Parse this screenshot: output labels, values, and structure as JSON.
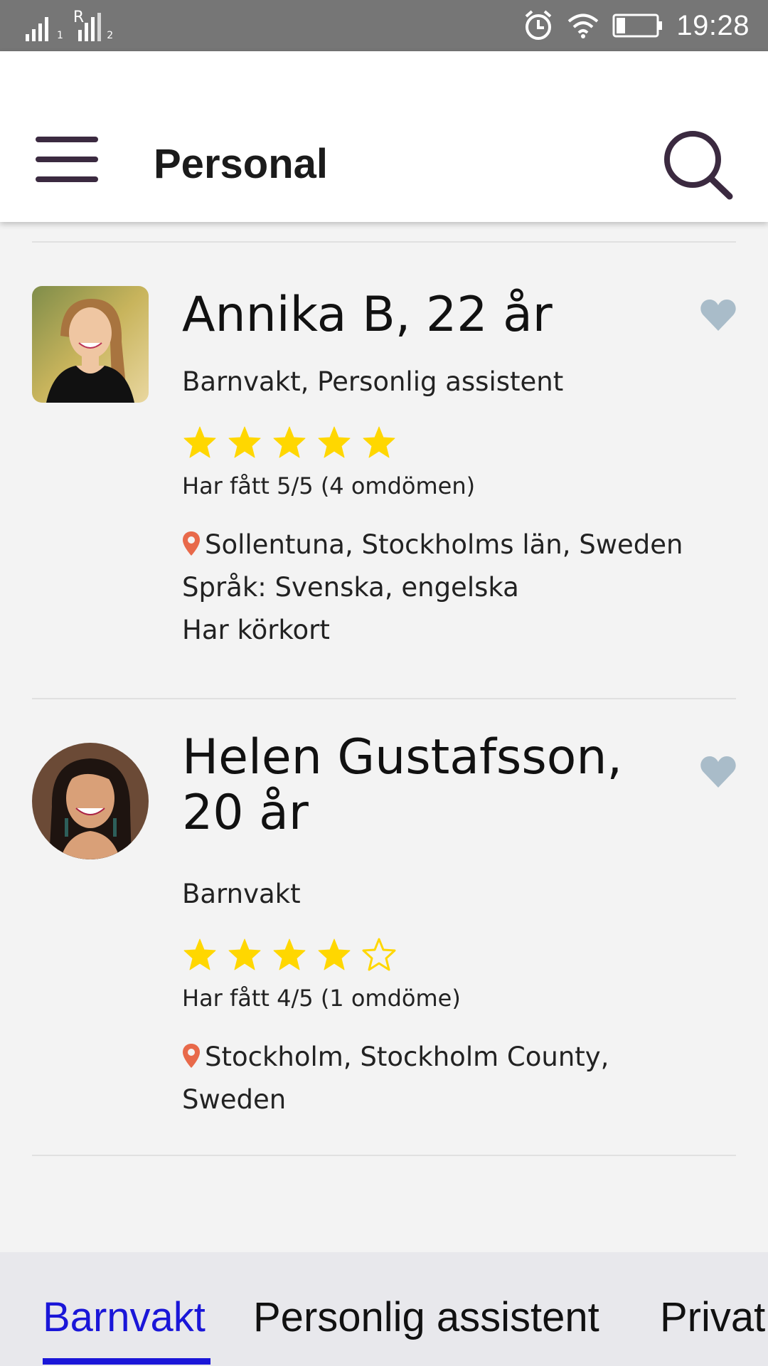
{
  "status_bar": {
    "signal_1": "1",
    "signal_2_prefix": "R",
    "signal_2": "2",
    "time": "19:28",
    "icons": [
      "signal-icon",
      "alarm-icon",
      "wifi-icon",
      "battery-icon"
    ]
  },
  "header": {
    "title": "Personal",
    "menu_icon": "hamburger-menu-icon",
    "search_icon": "search-icon"
  },
  "profiles": [
    {
      "name": "Annika B, 22 år",
      "roles": "Barnvakt, Personlig assistent",
      "rating": 5,
      "rating_text": "Har fått 5/5 (4 omdömen)",
      "location": "Sollentuna, Stockholms län, Sweden",
      "languages": "Språk: Svenska, engelska",
      "extra": "Har körkort",
      "avatar_shape": "rounded-square"
    },
    {
      "name": "Helen Gustafsson, 20 år",
      "roles": "Barnvakt",
      "rating": 4,
      "rating_text": "Har fått 4/5 (1 omdöme)",
      "location": "Stockholm, Stockholm County, Sweden",
      "avatar_shape": "circle"
    }
  ],
  "tabs": [
    {
      "label": "Barnvakt",
      "active": true
    },
    {
      "label": "Personlig assistent",
      "active": false
    },
    {
      "label": "Privat",
      "active": false
    }
  ],
  "colors": {
    "accent": "#1a16d8",
    "star": "#ffd700",
    "heart": "#a9bcc9",
    "pin": "#e8694a",
    "header_icon": "#3b2a40"
  }
}
